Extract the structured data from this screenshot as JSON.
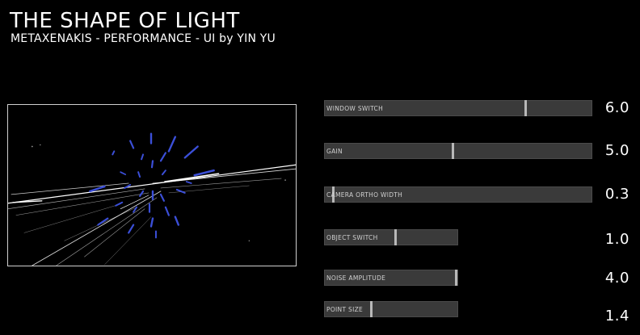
{
  "header": {
    "title": "THE SHAPE OF LIGHT",
    "subtitle": "METAXENAKIS - PERFORMANCE - UI by YIN YU"
  },
  "viewport": {
    "description_icon": "render-preview",
    "colors": {
      "background": "#000000",
      "border": "#cfcfcf",
      "lines": "#ffffff",
      "particles": "#3b4fd8"
    }
  },
  "sliders": [
    {
      "id": "window-switch",
      "label": "WINDOW SWITCH",
      "value": "6.0",
      "fill": 0.75
    },
    {
      "id": "gain",
      "label": "GAIN",
      "value": "5.0",
      "fill": 0.48
    },
    {
      "id": "camera-ortho-width",
      "label": "CAMERA ORTHO WIDTH",
      "value": "0.3",
      "fill": 0.03
    },
    {
      "id": "object-switch",
      "label": "OBJECT SWITCH",
      "value": "1.0",
      "fill": 0.53
    },
    {
      "id": "noise-amplitude",
      "label": "NOISE AMPLITUDE",
      "value": "4.0",
      "fill": 0.99
    },
    {
      "id": "point-size",
      "label": "POINT SIZE",
      "value": "1.4",
      "fill": 0.35
    }
  ],
  "colors": {
    "background": "#000000",
    "slider_track": "#3a3a3a",
    "slider_handle": "#b8b8b8",
    "text": "#ffffff"
  }
}
